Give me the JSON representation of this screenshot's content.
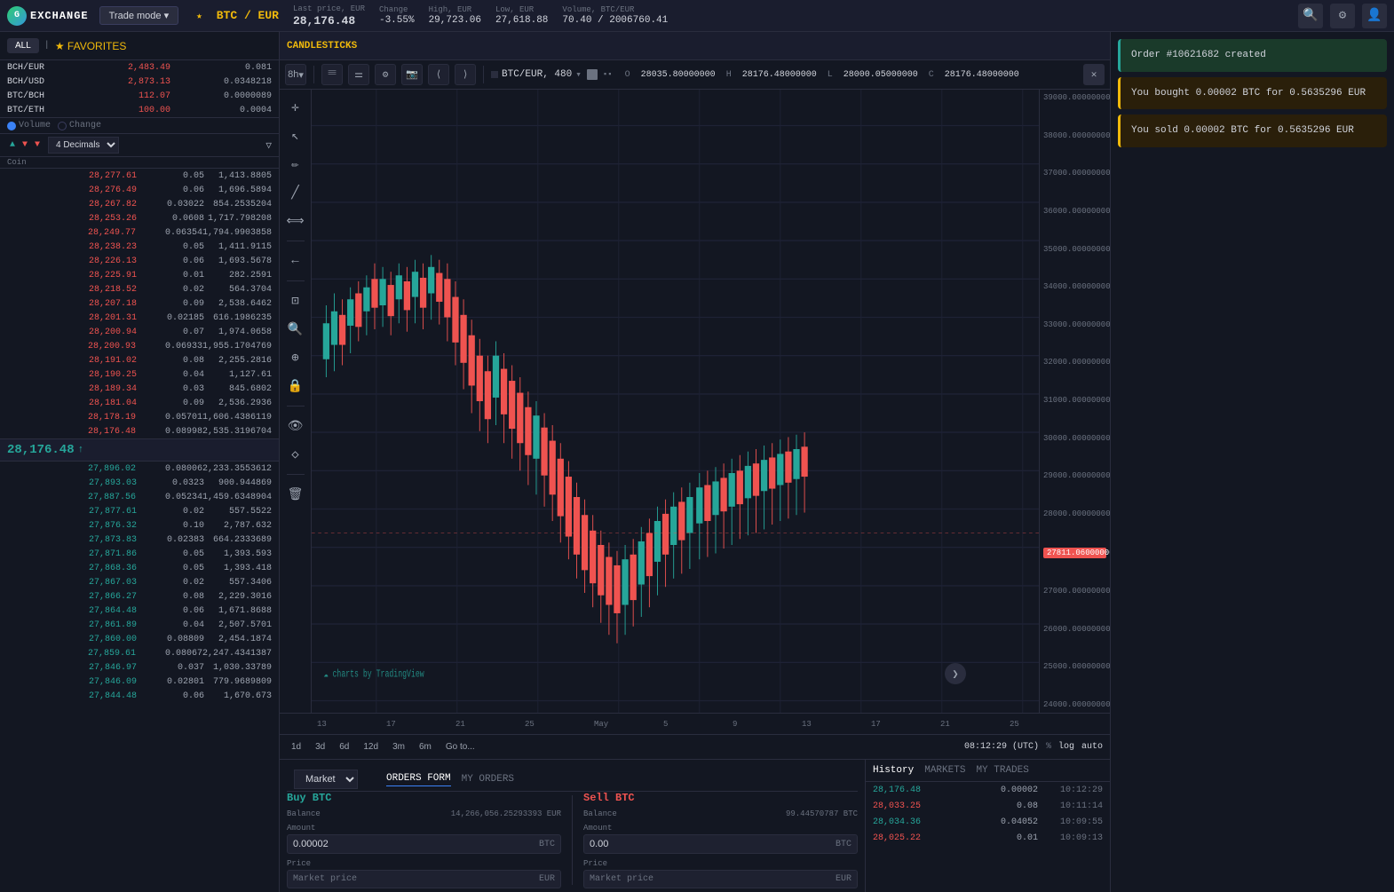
{
  "header": {
    "logo_text": "EXCHANGE",
    "logo_initial": "G",
    "trade_mode_label": "Trade mode",
    "trade_mode_arrow": "▾",
    "pair": "BTC / EUR",
    "star": "★",
    "last_price_label": "Last price, EUR",
    "last_price": "28,176.48",
    "change_label": "Change",
    "change": "-3.55%",
    "high_label": "High, EUR",
    "high": "29,723.06",
    "low_label": "Low, EUR",
    "low": "27,618.88",
    "volume_label": "Volume, BTC/EUR",
    "volume": "70.40 / 2006760.41"
  },
  "order_book": {
    "filters": [
      "ALL",
      "FAVORITES"
    ],
    "coins": [
      {
        "name": "BCH/EUR",
        "price": "2,483.49",
        "vol": "0.081",
        "color": "red"
      },
      {
        "name": "BCH/USD",
        "price": "2,873.13",
        "vol": "0.0348218",
        "color": "red"
      },
      {
        "name": "BTC/BCH",
        "price": "112.07",
        "vol": "0.0000089",
        "color": "red"
      },
      {
        "name": "BTC/ETH",
        "price": "100.00",
        "vol": "0.0004",
        "color": "red"
      }
    ],
    "decimals": "4 Decimals",
    "asks": [
      {
        "price": "28,277.61",
        "amount": "0.05",
        "total": "1,413.8805"
      },
      {
        "price": "28,276.49",
        "amount": "0.06",
        "total": "1,696.5894"
      },
      {
        "price": "28,267.82",
        "amount": "0.03022",
        "total": "854.2535204"
      },
      {
        "price": "28,253.26",
        "amount": "0.0608",
        "total": "1,717.798208"
      },
      {
        "price": "28,249.77",
        "amount": "0.06354",
        "total": "1,794.9903858"
      },
      {
        "price": "28,238.23",
        "amount": "0.05",
        "total": "1,411.9115"
      },
      {
        "price": "28,226.13",
        "amount": "0.06",
        "total": "1,693.5678"
      },
      {
        "price": "28,225.91",
        "amount": "0.01",
        "total": "282.2591"
      },
      {
        "price": "28,218.52",
        "amount": "0.02",
        "total": "564.3704"
      },
      {
        "price": "28,207.18",
        "amount": "0.09",
        "total": "2,538.6462"
      },
      {
        "price": "28,201.31",
        "amount": "0.02185",
        "total": "616.1986235"
      },
      {
        "price": "28,200.94",
        "amount": "0.07",
        "total": "1,974.0658"
      },
      {
        "price": "28,200.93",
        "amount": "0.06933",
        "total": "1,955.1704769"
      },
      {
        "price": "28,191.02",
        "amount": "0.08",
        "total": "2,255.2816"
      },
      {
        "price": "28,190.25",
        "amount": "0.04",
        "total": "1,127.61"
      },
      {
        "price": "28,189.34",
        "amount": "0.03",
        "total": "845.6802"
      },
      {
        "price": "28,181.04",
        "amount": "0.09",
        "total": "2,536.2936"
      },
      {
        "price": "28,178.19",
        "amount": "0.05701",
        "total": "1,606.4386119"
      },
      {
        "price": "28,176.48",
        "amount": "0.08998",
        "total": "2,535.3196704"
      }
    ],
    "mid_price": "28,176.48",
    "bids": [
      {
        "price": "27,896.02",
        "amount": "0.08006",
        "total": "2,233.3553612"
      },
      {
        "price": "27,893.03",
        "amount": "0.0323",
        "total": "900.944869"
      },
      {
        "price": "27,887.56",
        "amount": "0.05234",
        "total": "1,459.6348904"
      },
      {
        "price": "27,877.61",
        "amount": "0.02",
        "total": "557.5522"
      },
      {
        "price": "27,876.32",
        "amount": "0.10",
        "total": "2,787.632"
      },
      {
        "price": "27,873.83",
        "amount": "0.02383",
        "total": "664.2333689"
      },
      {
        "price": "27,871.86",
        "amount": "0.05",
        "total": "1,393.593"
      },
      {
        "price": "27,868.36",
        "amount": "0.05",
        "total": "1,393.418"
      },
      {
        "price": "27,867.03",
        "amount": "0.02",
        "total": "557.3406"
      },
      {
        "price": "27,866.27",
        "amount": "0.08",
        "total": "2,229.3016"
      },
      {
        "price": "27,864.48",
        "amount": "0.06",
        "total": "1,671.8688"
      },
      {
        "price": "27,861.89",
        "amount": "0.04",
        "total": "2,507.5701"
      },
      {
        "price": "27,860.00",
        "amount": "0.08809",
        "total": "2,454.1874"
      },
      {
        "price": "27,859.61",
        "amount": "0.08067",
        "total": "2,247.4341387"
      },
      {
        "price": "27,846.97",
        "amount": "0.037",
        "total": "1,030.33789"
      },
      {
        "price": "27,846.09",
        "amount": "0.02801",
        "total": "779.9689809"
      },
      {
        "price": "27,844.48",
        "amount": "0.06",
        "total": "1,670.673"
      }
    ]
  },
  "chart": {
    "title": "CANDLESTICKS",
    "pair_display": "BTC/EUR, 480",
    "timeframe": "8h",
    "ohlc": {
      "o_label": "O",
      "o_val": "28035.80000000",
      "h_label": "H",
      "h_val": "28176.48000000",
      "l_label": "L",
      "l_val": "28000.05000000",
      "c_label": "C",
      "c_val": "28176.48000000"
    },
    "timeframes": [
      "1d",
      "3d",
      "6d",
      "12d",
      "3m",
      "6m",
      "Go to..."
    ],
    "dates": [
      "13",
      "17",
      "21",
      "25",
      "May",
      "5",
      "9",
      "13",
      "17",
      "21",
      "25"
    ],
    "current_price": "27811.06000000",
    "price_scale": [
      "39000.00000000",
      "38000.00000000",
      "37000.00000000",
      "36000.00000000",
      "35000.00000000",
      "34000.00000000",
      "33000.00000000",
      "32000.00000000",
      "31000.00000000",
      "30000.00000000",
      "29000.00000000",
      "28000.00000000",
      "27000.00000000",
      "26000.00000000",
      "25000.00000000",
      "24000.00000000"
    ],
    "bottom_left": "charts by TradingView",
    "time_label": "08:12:29 (UTC)",
    "log_label": "log",
    "auto_label": "auto"
  },
  "order_form": {
    "market_type": "Market",
    "tabs": [
      "ORDERS FORM",
      "MY ORDERS"
    ],
    "buy_title": "Buy BTC",
    "sell_title": "Sell BTC",
    "balance_buy_label": "Balance",
    "balance_buy_val": "14,266,056.25293393 EUR",
    "balance_sell_label": "Balance",
    "balance_sell_val": "99.44570787 BTC",
    "amount_label": "Amount",
    "buy_amount": "0.00002",
    "sell_amount": "0.00",
    "btc_suffix": "BTC",
    "price_label": "Price",
    "market_price": "Market price",
    "eur_suffix": "EUR"
  },
  "history": {
    "tabs": [
      "History",
      "MARKETS",
      "MY TRADES"
    ],
    "rows": [
      {
        "price": "28,176.48",
        "amount": "0.00002",
        "time": "10:12:29",
        "color": "green"
      },
      {
        "price": "28,033.25",
        "amount": "0.08",
        "time": "10:11:14",
        "color": "red"
      },
      {
        "price": "28,034.36",
        "amount": "0.04052",
        "time": "10:09:55",
        "color": "green"
      },
      {
        "price": "28,025.22",
        "amount": "0.01",
        "time": "10:09:13",
        "color": "red"
      }
    ]
  },
  "notifications": {
    "order_created": {
      "text": "Order #10621682 created",
      "type": "green"
    },
    "bought": {
      "text": "You bought 0.00002 BTC for 0.5635296 EUR",
      "type": "yellow"
    },
    "sold": {
      "text": "You sold 0.00002 BTC for 0.5635296 EUR",
      "type": "yellow"
    }
  },
  "toolbar_tools": {
    "crosshair": "+",
    "cursor": "↖",
    "pencil": "✏",
    "line": "╱",
    "xline": "⟺",
    "measure": "⊡",
    "magnet": "⊕",
    "flag": "⚑",
    "lock": "🔒",
    "eye": "👁",
    "diamond": "◇",
    "trash": "🗑"
  }
}
